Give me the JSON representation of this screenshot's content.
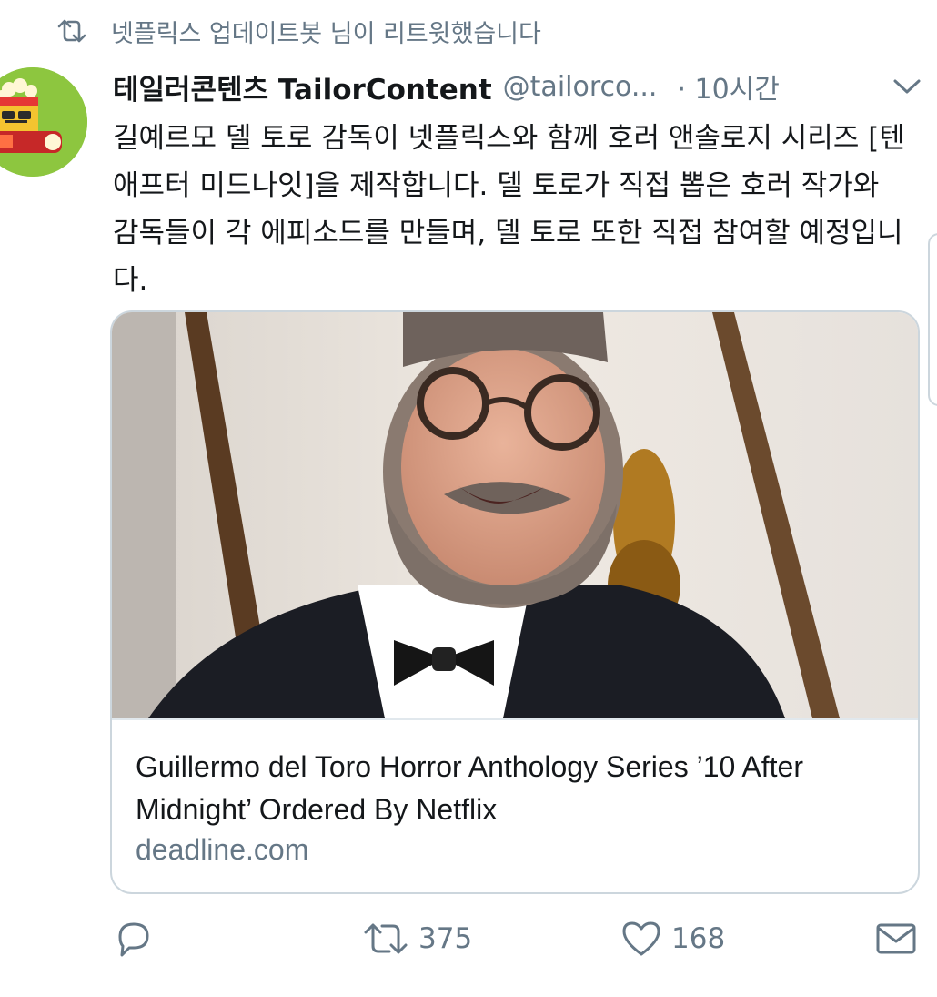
{
  "retweet_context": {
    "icon": "retweet-icon",
    "text": "넷플릭스 업데이트봇 님이 리트윗했습니다"
  },
  "tweet": {
    "avatar_icon": "popcorn-avatar-icon",
    "display_name": "테일러콘텐츠 TailorContent",
    "handle": "@tailorco...",
    "time": "· 10시간",
    "menu_icon": "chevron-down-icon",
    "text": "길예르모 델 토로 감독이 넷플릭스와 함께 호러 앤솔로지 시리즈 [텐 애프터 미드나잇]을 제작합니다. 델 토로가 직접 뽑은 호러 작가와 감독들이 각 에피소드를 만들며, 델 토로 또한 직접 참여할 예정입니다."
  },
  "card": {
    "image": "smiling-man-with-glasses-photo",
    "title": "Guillermo del Toro Horror Anthology Series ’10 After Midnight’   Ordered By Netflix",
    "domain": "deadline.com"
  },
  "actions": {
    "reply_icon": "reply-icon",
    "retweet_icon": "retweet-icon",
    "retweet_count": "375",
    "like_icon": "heart-icon",
    "like_count": "168",
    "message_icon": "mail-icon"
  },
  "colors": {
    "text": "#14171a",
    "secondary": "#657786",
    "border": "#ccd6dd"
  }
}
